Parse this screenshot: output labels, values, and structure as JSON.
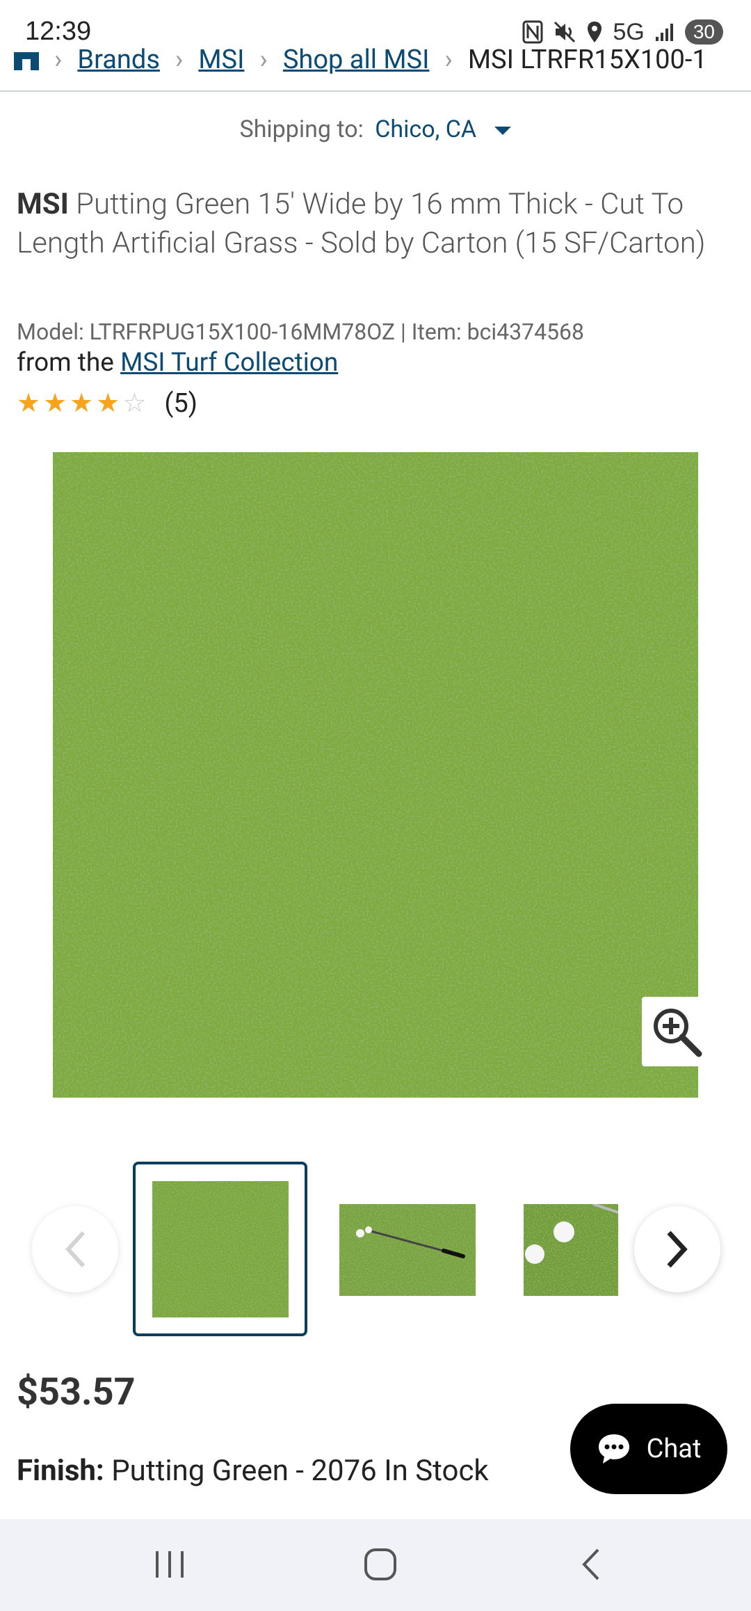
{
  "status_bar": {
    "time": "12:39",
    "network": "5G",
    "battery": "30"
  },
  "breadcrumb": {
    "items": [
      "Brands",
      "MSI",
      "Shop all MSI"
    ],
    "current": "MSI LTRFR15X100-1"
  },
  "shipping": {
    "label": "Shipping to:",
    "location": "Chico, CA"
  },
  "product": {
    "brand": "MSI",
    "title": "Putting Green 15' Wide by 16 mm Thick - Cut To Length Artificial Grass - Sold by Carton (15 SF/Carton)",
    "model_line": "Model: LTRFRPUG15X100-16MM78OZ | Item: bci4374568",
    "collection_prefix": "from the",
    "collection_link": "MSI Turf Collection",
    "rating_value": 4,
    "rating_max": 5,
    "rating_count": "(5)",
    "price": "$53.57",
    "finish_label": "Finish:",
    "finish_value": "Putting Green - 2076 In Stock"
  },
  "gallery": {
    "selected_index": 0,
    "thumbnails": [
      "turf-swatch",
      "golf-club-on-green",
      "golf-balls-on-green"
    ]
  },
  "chat": {
    "label": "Chat"
  },
  "colors": {
    "link": "#0b4a72",
    "star": "#f7a31c",
    "grass": "#6e9a36"
  }
}
